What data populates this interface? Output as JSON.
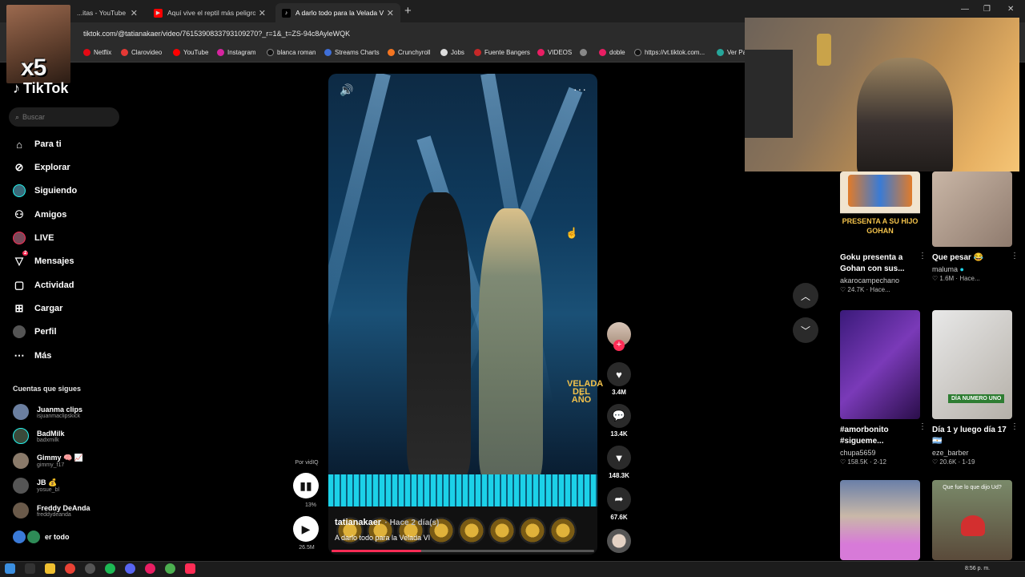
{
  "browser": {
    "tabs": [
      {
        "label": "...itas - YouTube"
      },
      {
        "label": "Aquí vive el reptil más peligroso"
      },
      {
        "label": "A darlo todo para la Velada VI |"
      }
    ],
    "url": "tiktok.com/@tatianakaer/video/7615390833793109270?_r=1&_t=ZS-94c8AyleWQK",
    "bookmarks": [
      "Netflix",
      "Clarovideo",
      "YouTube",
      "Instagram",
      "blanca roman",
      "Streams Charts",
      "Crunchyroll",
      "Jobs",
      "Fuente Bangers",
      "VIDEOS",
      "doble",
      "https://vt.tiktok.com...",
      "Ver Pa"
    ]
  },
  "overlay": {
    "multiplier": "x5"
  },
  "sidebar": {
    "logo": "TikTok",
    "search_placeholder": "Buscar",
    "nav": [
      {
        "label": "Para ti",
        "icon": "home-icon"
      },
      {
        "label": "Explorar",
        "icon": "compass-icon"
      },
      {
        "label": "Siguiendo",
        "icon": "following-avatar"
      },
      {
        "label": "Amigos",
        "icon": "friends-icon"
      },
      {
        "label": "LIVE",
        "icon": "live-avatar"
      },
      {
        "label": "Mensajes",
        "icon": "messages-icon",
        "badge": "2"
      },
      {
        "label": "Actividad",
        "icon": "activity-icon"
      },
      {
        "label": "Cargar",
        "icon": "upload-icon"
      },
      {
        "label": "Perfil",
        "icon": "profile-avatar"
      },
      {
        "label": "Más",
        "icon": "more-icon"
      }
    ],
    "following_title": "Cuentas que sigues",
    "accounts": [
      {
        "name": "Juanma clips",
        "handle": "isjuanmaclipskick"
      },
      {
        "name": "BadMilk",
        "handle": "badxmilk"
      },
      {
        "name": "Gimmy 🧠 📈",
        "handle": "gimmy_f17"
      },
      {
        "name": "JB 💰",
        "handle": "yosue_bl"
      },
      {
        "name": "Freddy DeAnda",
        "handle": "freddydeanda"
      }
    ],
    "see_all": "er todo"
  },
  "player": {
    "author": "tatianakaer",
    "time": "· Hace 2 día(s)",
    "description": "A darlo todo para la Velada VI",
    "watermark": "VELADA DEL AÑO",
    "progress_fraction": 0.34,
    "left": {
      "por": "Por vidIQ",
      "pct": "13%",
      "views": "26.5M"
    }
  },
  "actions": [
    {
      "icon": "heart-icon",
      "count": "3.4M"
    },
    {
      "icon": "comment-icon",
      "count": "13.4K"
    },
    {
      "icon": "bookmark-icon",
      "count": "148.3K"
    },
    {
      "icon": "share-icon",
      "count": "67.6K"
    }
  ],
  "related": [
    {
      "title": "Goku presenta a Gohan con sus...",
      "author": "akarocampechano",
      "likes": "24.7K",
      "time": "Hace...",
      "thumb_text": "PRESENTA A SU HIJO GOHAN"
    },
    {
      "title": "Que pesar 😂",
      "author": "maluma",
      "verified": true,
      "likes": "1.6M",
      "time": "Hace..."
    },
    {
      "title": "#amorbonito #sigueme...",
      "author": "chupa5659",
      "likes": "158.5K",
      "time": "2-12"
    },
    {
      "title": "Día 1 y luego día 17 🇦🇷",
      "author": "eze_barber",
      "likes": "20.6K",
      "time": "1-19",
      "thumb_text": "DÍA NUMERO UNO"
    },
    {
      "title": "",
      "author": "",
      "likes": "",
      "time": ""
    },
    {
      "title": "",
      "author": "",
      "likes": "",
      "time": "",
      "thumb_text": "Que fue lo que dijo Ud?"
    }
  ],
  "taskbar": {
    "time": "8:56 p. m."
  }
}
